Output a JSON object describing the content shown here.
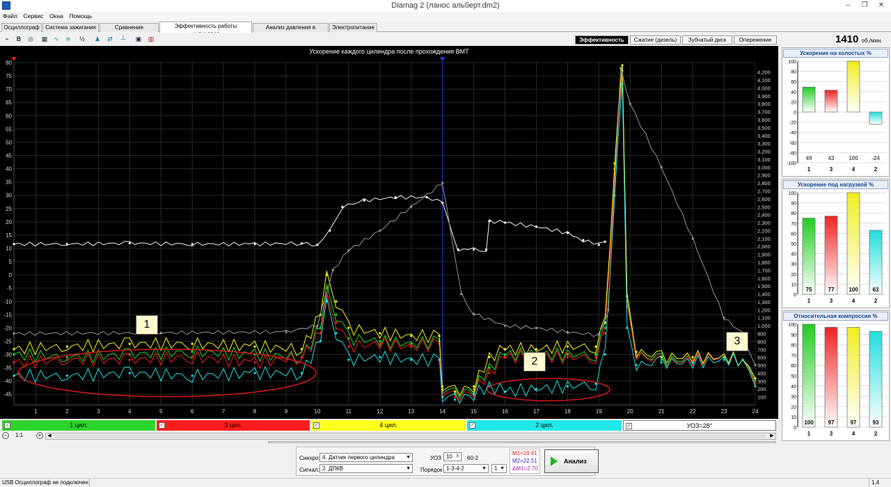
{
  "window": {
    "title": "Diamag 2 (ланос альберт.dm2)",
    "controls": [
      "–",
      "❐",
      "✕"
    ]
  },
  "menu": [
    "Файл",
    "Сервис",
    "Окна",
    "Помощь"
  ],
  "tabs": [
    "Осциллограф",
    "Система зажигания",
    "Сравнение цилиндров",
    "Эффективность работы цилиндров",
    "Анализ давления в цилиндре",
    "Электропитание"
  ],
  "active_tab": 3,
  "toolbar_icons": [
    "waveform-icon",
    "bold-b-icon",
    "sensor-icon",
    "table-icon",
    "curve-icon",
    "wave-icon",
    "abc-icon",
    "person-icon",
    "arrows-icon",
    "chart-icon",
    "car-icon",
    "engine-icon"
  ],
  "mode_buttons": [
    "Эффективность",
    "Сжатие (дизель)",
    "Зубчатый диск",
    "Опережение"
  ],
  "rpm": {
    "value": "1410",
    "unit": "об./мин."
  },
  "chart_data": [
    {
      "type": "line",
      "title": "Ускорение каждого цилиндра после прохождения ВМТ",
      "x_ticks": [
        "1",
        "2",
        "3",
        "4",
        "5",
        "6",
        "7",
        "8",
        "9",
        "10",
        "11",
        "12",
        "13",
        "14",
        "15",
        "16",
        "17",
        "18",
        "19",
        "20",
        "21",
        "22",
        "23",
        "24"
      ],
      "xlim": [
        0.3,
        24
      ],
      "y_left_ticks": [
        "80",
        "75",
        "70",
        "65",
        "60",
        "55",
        "50",
        "45",
        "40",
        "35",
        "30",
        "25",
        "20",
        "15",
        "10",
        "5",
        "0",
        "-5",
        "-10",
        "-15",
        "-20",
        "-25",
        "-30",
        "-35",
        "-40",
        "-45"
      ],
      "ylim_left": [
        -49,
        80
      ],
      "y_right_ticks": [
        "4,200",
        "4,100",
        "4,000",
        "3,900",
        "3,800",
        "3,700",
        "3,600",
        "3,500",
        "3,400",
        "3,300",
        "3,200",
        "3,100",
        "3,000",
        "2,900",
        "2,800",
        "2,700",
        "2,600",
        "2,500",
        "2,400",
        "2,300",
        "2,200",
        "2,100",
        "2,000",
        "1,900",
        "1,800",
        "1,700",
        "1,600",
        "1,500",
        "1,400",
        "1,300",
        "1,200",
        "1,100",
        "1,000",
        "900",
        "800",
        "700",
        "600",
        "500",
        "400",
        "300",
        "200",
        "100"
      ],
      "ylim_right": [
        0,
        4320
      ],
      "grid": true,
      "series": [
        {
          "name": "1 цил.",
          "color": "#22dd22",
          "x": [
            0.3,
            2,
            4,
            6,
            8,
            9.5,
            10.1,
            10.3,
            10.6,
            11,
            12,
            13,
            13.9,
            14,
            14.4,
            15,
            15.5,
            16,
            17,
            18,
            18.9,
            19.2,
            19.5,
            19.75,
            19.9,
            20.2,
            21,
            22,
            23,
            23.6,
            24
          ],
          "y": [
            -30,
            -31,
            -30,
            -29,
            -30,
            -31,
            -20,
            -5,
            -15,
            -24,
            -25,
            -26,
            -25,
            -43,
            -45,
            -43,
            -35,
            -30,
            -30,
            -30,
            -30,
            -20,
            40,
            77,
            -10,
            -30,
            -32,
            -32,
            -31,
            -32,
            -40
          ]
        },
        {
          "name": "3 цил.",
          "color": "#ff2020",
          "x": [
            0.3,
            2,
            4,
            6,
            8,
            9.5,
            10.1,
            10.3,
            10.6,
            11,
            12,
            13,
            13.9,
            14,
            14.4,
            15,
            15.5,
            16,
            17,
            18,
            18.9,
            19.2,
            19.5,
            19.75,
            19.9,
            20.2,
            21,
            22,
            23,
            23.6,
            24
          ],
          "y": [
            -33,
            -32,
            -32,
            -31,
            -33,
            -31,
            -22,
            -8,
            -18,
            -27,
            -26,
            -27,
            -26,
            -44,
            -46,
            -44,
            -37,
            -31,
            -31,
            -31,
            -31,
            -22,
            38,
            75,
            -12,
            -30,
            -33,
            -32,
            -31,
            -32,
            -41
          ]
        },
        {
          "name": "4 цил.",
          "color": "#ffff20",
          "x": [
            0.3,
            2,
            4,
            6,
            8,
            9.5,
            10.1,
            10.3,
            10.6,
            11,
            12,
            13,
            13.9,
            14,
            14.4,
            15,
            15.5,
            16,
            17,
            18,
            18.9,
            19.2,
            19.5,
            19.75,
            19.9,
            20.2,
            21,
            22,
            23,
            23.6,
            24
          ],
          "y": [
            -28,
            -27,
            -26,
            -26,
            -27,
            -28,
            -15,
            0,
            -10,
            -20,
            -22,
            -23,
            -23,
            -42,
            -44,
            -42,
            -31,
            -28,
            -28,
            -27,
            -27,
            -18,
            42,
            79,
            -8,
            -29,
            -31,
            -31,
            -31,
            -32,
            -39
          ]
        },
        {
          "name": "2 цил.",
          "color": "#20e8e8",
          "x": [
            0.3,
            2,
            4,
            6,
            8,
            9.5,
            10.1,
            10.3,
            10.6,
            11,
            12,
            13,
            13.9,
            14,
            14.4,
            15,
            15.5,
            16,
            17,
            18,
            18.9,
            19.2,
            19.5,
            19.75,
            19.9,
            20.2,
            21,
            22,
            23,
            23.6,
            24
          ],
          "y": [
            -38,
            -38,
            -37,
            -38,
            -37,
            -37,
            -25,
            -10,
            -22,
            -32,
            -31,
            -32,
            -32,
            -46,
            -47,
            -45,
            -42,
            -44,
            -43,
            -42,
            -41,
            -30,
            30,
            72,
            -20,
            -34,
            -33,
            -33,
            -32,
            -32,
            -42
          ]
        },
        {
          "name": "ВМТ",
          "color": "#ffffff",
          "axis": "right",
          "x": [
            0.3,
            2,
            4,
            6,
            8,
            9.5,
            10,
            10.4,
            10.8,
            11.5,
            12.5,
            13.5,
            14,
            14.5,
            15,
            15.4,
            15.5,
            16,
            17,
            18,
            18.5,
            19,
            19.2
          ],
          "y": [
            2030,
            2030,
            2040,
            2030,
            2030,
            2040,
            2020,
            2200,
            2500,
            2580,
            2620,
            2620,
            2550,
            1960,
            1960,
            1960,
            2320,
            2300,
            2250,
            2170,
            2080,
            2020,
            2060
          ]
        },
        {
          "name": "УОЗ=28°",
          "color": "#9a9a9a",
          "axis": "right",
          "x": [
            0.3,
            5,
            9,
            10,
            10.5,
            11,
            12,
            13,
            14,
            14.6,
            15,
            16,
            17,
            18,
            19,
            19.3,
            19.7,
            20,
            21,
            22,
            23,
            23.6,
            24
          ],
          "y": [
            900,
            910,
            920,
            1000,
            1700,
            1950,
            2200,
            2500,
            2800,
            1400,
            1150,
            1000,
            970,
            920,
            880,
            1200,
            4250,
            3800,
            3000,
            2100,
            1100,
            900,
            500
          ]
        }
      ],
      "annotations": [
        "1",
        "2",
        "3"
      ]
    },
    {
      "type": "bar",
      "title": "Ускорение на холостых %",
      "categories": [
        "1",
        "3",
        "4",
        "2"
      ],
      "values": [
        49,
        43,
        100,
        -24
      ],
      "ylim": [
        -100,
        100
      ],
      "y_ticks": [
        "100",
        "80",
        "60",
        "40",
        "20",
        "0",
        "-20",
        "-40",
        "-60",
        "-80",
        "-100"
      ],
      "colors": [
        "#22cc22",
        "#ee2222",
        "#eeee22",
        "#22dddd"
      ]
    },
    {
      "type": "bar",
      "title": "Ускорение под нагрузкой %",
      "categories": [
        "1",
        "3",
        "4",
        "2"
      ],
      "values": [
        75,
        77,
        100,
        63
      ],
      "ylim": [
        0,
        100
      ],
      "y_ticks": [
        "100",
        "90",
        "80",
        "70",
        "60",
        "50",
        "40",
        "30",
        "20",
        "10",
        "0"
      ],
      "colors": [
        "#22cc22",
        "#ee2222",
        "#eeee22",
        "#22dddd"
      ]
    },
    {
      "type": "bar",
      "title": "Относительная компрессия %",
      "categories": [
        "1",
        "3",
        "4",
        "2"
      ],
      "values": [
        100,
        97,
        97,
        93
      ],
      "ylim": [
        0,
        100
      ],
      "y_ticks": [
        "100",
        "90",
        "80",
        "70",
        "60",
        "50",
        "40",
        "30",
        "20",
        "10",
        "0"
      ],
      "colors": [
        "#22cc22",
        "#ee2222",
        "#eeee22",
        "#22dddd"
      ]
    }
  ],
  "legend": [
    {
      "label": "1 цил.",
      "color": "#22dd22"
    },
    {
      "label": "3 цил.",
      "color": "#ff2020"
    },
    {
      "label": "4 цил.",
      "color": "#ffff20"
    },
    {
      "label": "2 цил.",
      "color": "#20e8e8"
    },
    {
      "label": "УОЗ=28°",
      "color": "#ffffff"
    }
  ],
  "zoom": "1:1",
  "bottom": {
    "sync_label": "Синхро:",
    "sync_value": "4. Датчик первого цилиндра",
    "signal_label": "Сигнал:",
    "signal_value": "2. ДПКВ",
    "uoz_label": "УОЗ",
    "uoz_value": "10",
    "disk": "60-2",
    "order_label": "Порядок",
    "order_value": "1-3-4-2",
    "order_extra": "1",
    "m1": "M1=19.81",
    "m2": "M2=22.51",
    "dm1": "ΔM1=2.70",
    "analyze_label": "Анализ"
  },
  "status": {
    "left": "USB Осциллограф не подключен",
    "right": "1.4"
  }
}
